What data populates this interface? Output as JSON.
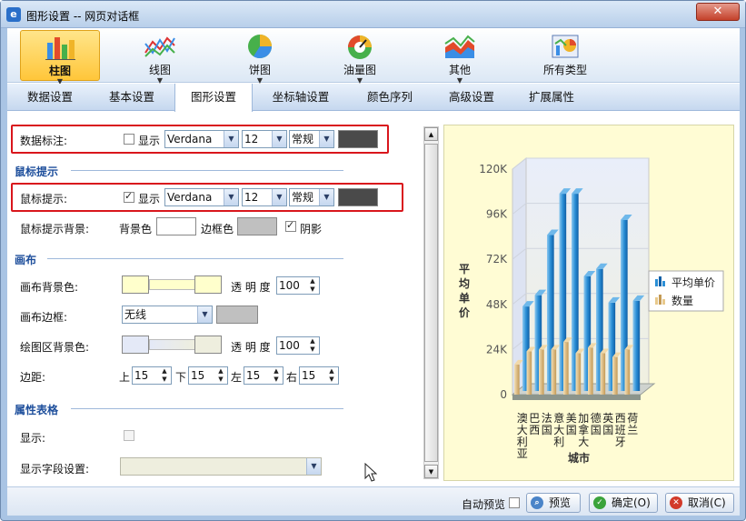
{
  "window": {
    "title": "图形设置 -- 网页对话框",
    "close": "✕"
  },
  "toolbar": [
    {
      "label": "柱图",
      "icon": "bar-chart-icon"
    },
    {
      "label": "线图",
      "icon": "line-chart-icon"
    },
    {
      "label": "饼图",
      "icon": "pie-chart-icon"
    },
    {
      "label": "油量图",
      "icon": "gauge-chart-icon"
    },
    {
      "label": "其他",
      "icon": "area-chart-icon"
    },
    {
      "label": "所有类型",
      "icon": "all-types-icon"
    }
  ],
  "tabs": [
    "数据设置",
    "基本设置",
    "图形设置",
    "坐标轴设置",
    "颜色序列",
    "高级设置",
    "扩展属性"
  ],
  "form": {
    "data_label": {
      "label": "数据标注:",
      "show": "显示",
      "font": "Verdana",
      "size": "12",
      "style": "常规"
    },
    "tooltip_section": "鼠标提示",
    "tooltip": {
      "label": "鼠标提示:",
      "show": "显示",
      "font": "Verdana",
      "size": "12",
      "style": "常规"
    },
    "tooltip_bg": {
      "label": "鼠标提示背景:",
      "bg": "背景色",
      "border": "边框色",
      "shadow": "阴影"
    },
    "canvas_section": "画布",
    "canvas_bg": {
      "label": "画布背景色:",
      "opacity_label": "透 明 度",
      "opacity": "100"
    },
    "canvas_border": {
      "label": "画布边框:",
      "value": "无线"
    },
    "plot_bg": {
      "label": "绘图区背景色:",
      "opacity_label": "透 明 度",
      "opacity": "100"
    },
    "margin": {
      "label": "边距:",
      "top_label": "上",
      "top": "15",
      "bottom_label": "下",
      "bottom": "15",
      "left_label": "左",
      "left": "15",
      "right_label": "右",
      "right": "15"
    },
    "prop_section": "属性表格",
    "prop_show": {
      "label": "显示:"
    },
    "prop_fields": {
      "label": "显示字段设置:"
    }
  },
  "colors": {
    "canvas_bg": "#ffffcc",
    "plot_bg": "#e4e9f7",
    "plot_bg2": "#eeeede",
    "swatch_dark": "#4a4a4a",
    "border_color": "#c0c0c0",
    "accent": "#1e4f9c"
  },
  "chart_data": {
    "type": "bar",
    "ylabel": "平均单价",
    "xlabel": "城市",
    "yticks": [
      "0",
      "24K",
      "48K",
      "72K",
      "96K",
      "120K"
    ],
    "ylim": [
      0,
      120000
    ],
    "categories": [
      "澳大利亚",
      "巴西",
      "法国",
      "意大利",
      "美国",
      "加拿大",
      "德国",
      "英国",
      "西班牙",
      "荷兰"
    ],
    "series": [
      {
        "name": "平均单价",
        "values": [
          44000,
          50000,
          82000,
          104000,
          104000,
          60000,
          64000,
          46000,
          90000,
          47000
        ]
      },
      {
        "name": "数量",
        "values": [
          16000,
          23000,
          24000,
          24000,
          28000,
          22000,
          25000,
          22000,
          20000,
          24000
        ]
      }
    ],
    "legend": "right"
  },
  "footer": {
    "auto_preview": "自动预览",
    "preview": "预览",
    "ok": "确定(O)",
    "cancel": "取消(C)"
  }
}
